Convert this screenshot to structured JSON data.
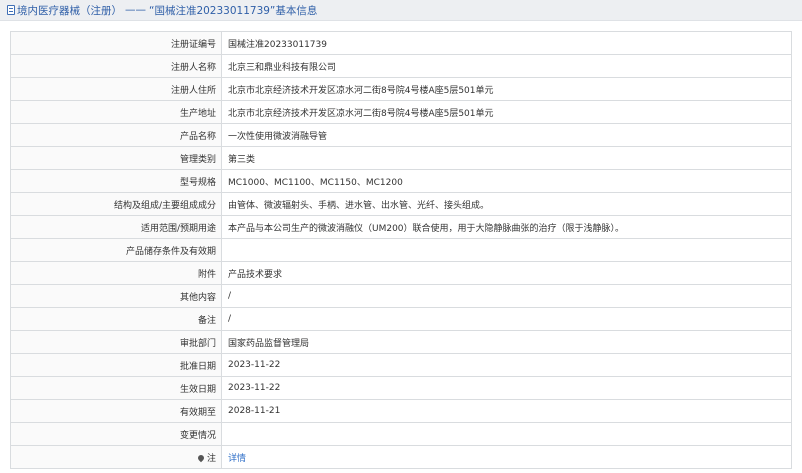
{
  "header": {
    "breadcrumb": "境内医疗器械（注册）",
    "separator": "——",
    "title": "“国械注准20233011739”基本信息"
  },
  "rows": [
    {
      "label": "注册证编号",
      "value": "国械注准20233011739"
    },
    {
      "label": "注册人名称",
      "value": "北京三和鼎业科技有限公司"
    },
    {
      "label": "注册人住所",
      "value": "北京市北京经济技术开发区凉水河二街8号院4号楼A座5层501单元"
    },
    {
      "label": "生产地址",
      "value": "北京市北京经济技术开发区凉水河二街8号院4号楼A座5层501单元"
    },
    {
      "label": "产品名称",
      "value": "一次性使用微波消融导管"
    },
    {
      "label": "管理类别",
      "value": "第三类"
    },
    {
      "label": "型号规格",
      "value": "MC1000、MC1100、MC1150、MC1200"
    },
    {
      "label": "结构及组成/主要组成成分",
      "value": "由管体、微波辐射头、手柄、进水管、出水管、光纤、接头组成。"
    },
    {
      "label": "适用范围/预期用途",
      "value": "本产品与本公司生产的微波消融仪（UM200）联合使用，用于大隐静脉曲张的治疗（限于浅静脉）。"
    },
    {
      "label": "产品储存条件及有效期",
      "value": ""
    },
    {
      "label": "附件",
      "value": "产品技术要求"
    },
    {
      "label": "其他内容",
      "value": "/"
    },
    {
      "label": "备注",
      "value": "/"
    },
    {
      "label": "审批部门",
      "value": "国家药品监督管理局"
    },
    {
      "label": "批准日期",
      "value": "2023-11-22"
    },
    {
      "label": "生效日期",
      "value": "2023-11-22"
    },
    {
      "label": "有效期至",
      "value": "2028-11-21"
    },
    {
      "label": "变更情况",
      "value": ""
    }
  ],
  "note_row": {
    "label": "注",
    "value": "详情",
    "icon": "pin-icon"
  }
}
